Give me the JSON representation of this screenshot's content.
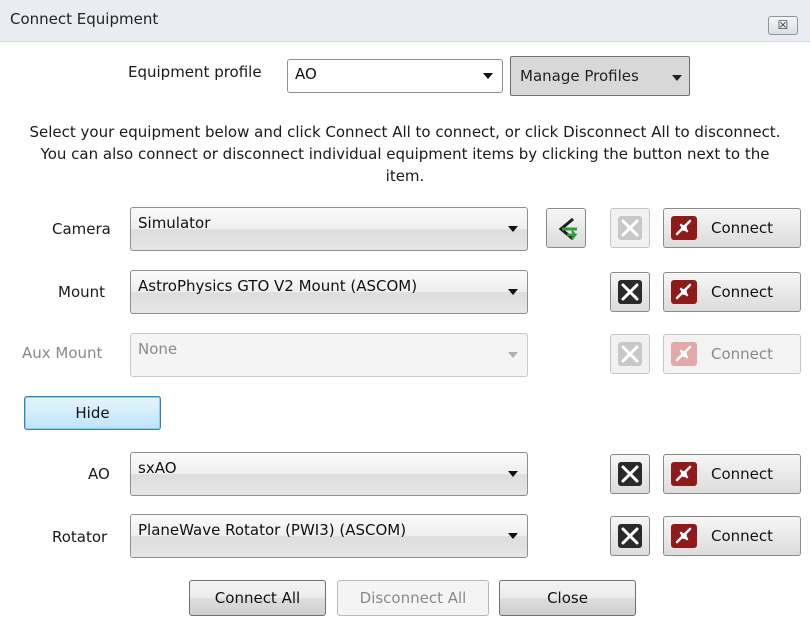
{
  "window": {
    "title": "Connect Equipment",
    "close_glyph": "☒"
  },
  "profile": {
    "label": "Equipment profile",
    "selected": "AO",
    "manage_label": "Manage Profiles"
  },
  "info_text": "Select your equipment below and click Connect All to connect, or click Disconnect All to disconnect. You can also connect or disconnect individual equipment items by clicking the button next to the item.",
  "rows": {
    "camera": {
      "label": "Camera",
      "selected": "Simulator",
      "connect_label": "Connect"
    },
    "mount": {
      "label": "Mount",
      "selected": "AstroPhysics GTO V2 Mount (ASCOM)",
      "connect_label": "Connect"
    },
    "aux_mount": {
      "label": "Aux Mount",
      "selected": "None",
      "connect_label": "Connect"
    },
    "ao": {
      "label": "AO",
      "selected": "sxAO",
      "connect_label": "Connect"
    },
    "rotator": {
      "label": "Rotator",
      "selected": "PlaneWave Rotator (PWI3) (ASCOM)",
      "connect_label": "Connect"
    }
  },
  "hide_label": "Hide",
  "footer": {
    "connect_all": "Connect All",
    "disconnect_all": "Disconnect All",
    "close": "Close"
  },
  "icons": {
    "setup": "wrench-screwdriver-icon",
    "connect": "plug-icon",
    "swap": "swap-arrows-icon"
  },
  "colors": {
    "connect_icon": "#8f1a1a",
    "setup_icon": "#2a2a2a",
    "swap_icon": "#2e9e3a",
    "hide_accent": "#3c7fb1"
  }
}
